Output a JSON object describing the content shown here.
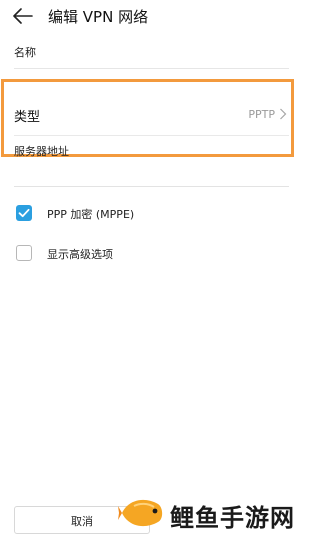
{
  "header": {
    "title": "编辑 VPN 网络",
    "back_icon": "back-arrow-icon"
  },
  "form": {
    "name_label": "名称",
    "type_label": "类型",
    "type_value": "PPTP",
    "server_label": "服务器地址"
  },
  "options": [
    {
      "label": "PPP 加密 (MPPE)",
      "checked": true
    },
    {
      "label": "显示高级选项",
      "checked": false
    }
  ],
  "footer": {
    "cancel_label": "取消"
  },
  "watermark": {
    "text": "鲤鱼手游网",
    "logo_icon": "fish-logo-icon"
  },
  "colors": {
    "accent": "#2b9fe0",
    "highlight": "#f39a3d"
  }
}
